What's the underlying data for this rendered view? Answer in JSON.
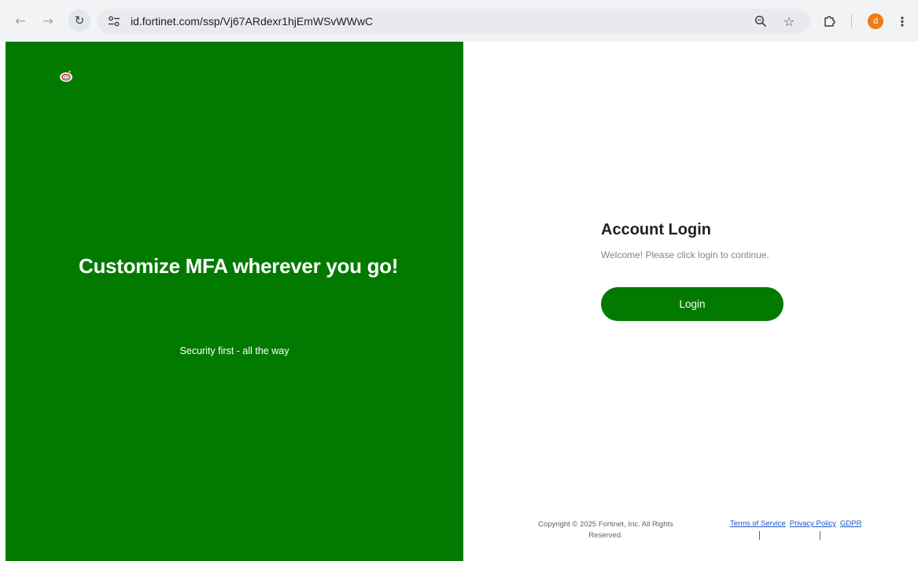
{
  "browser": {
    "url": "id.fortinet.com/ssp/Vj67ARdexr1hjEmWSvWWwC",
    "icons": {
      "back": "arrow-left-icon",
      "forward": "arrow-right-icon",
      "reload": "reload-icon",
      "site_info": "tune-icon",
      "zoom": "zoom-icon",
      "bookmark": "star-icon",
      "extensions": "puzzle-icon",
      "menu": "kebab-menu-icon"
    },
    "avatar_letter": "d",
    "avatar_color": "#f07b10"
  },
  "left_panel": {
    "background": "#027a00",
    "logo": "fortinet-logo-icon",
    "headline": "Customize MFA wherever you go!",
    "tagline": "Security first - all the way"
  },
  "right_panel": {
    "title": "Account Login",
    "subtitle": "Welcome! Please click login to continue.",
    "login_button": "Login",
    "button_color": "#027a00",
    "footer": {
      "copyright": "Copyright © 2025 Fortinet, Inc. All Rights Reserved.",
      "links": [
        "Terms of Service",
        "Privacy Policy",
        "GDPR"
      ]
    }
  }
}
